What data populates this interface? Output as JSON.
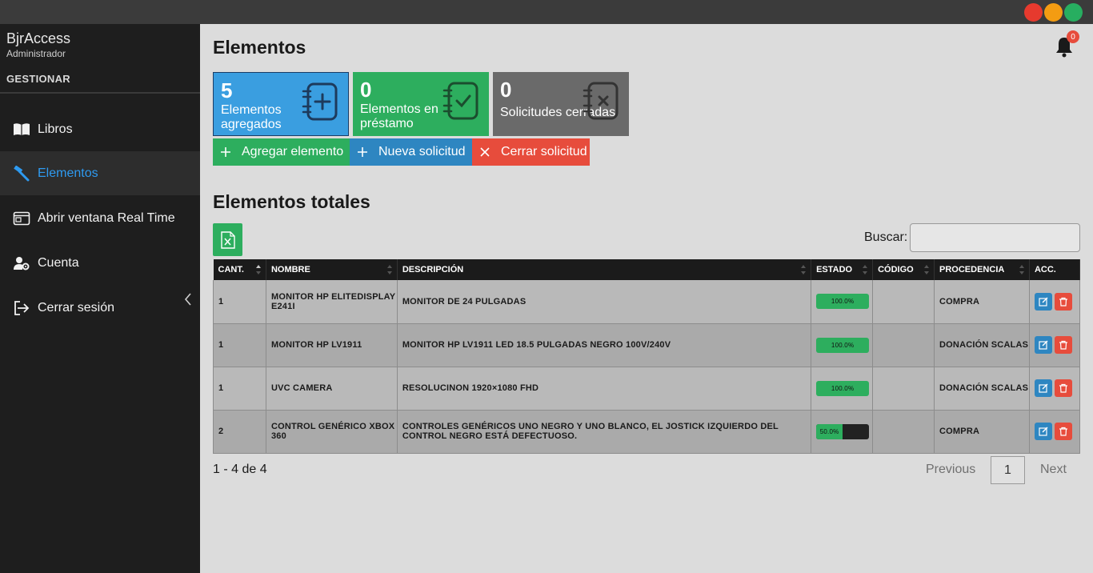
{
  "window": {
    "controls": [
      "close",
      "minimize",
      "maximize"
    ],
    "colors": {
      "close": "#e63a2e",
      "minimize": "#f39c12",
      "maximize": "#27ae60"
    }
  },
  "sidebar": {
    "app_name": "BjrAccess",
    "role": "Administrador",
    "section": "GESTIONAR",
    "items": [
      {
        "label": "Libros",
        "icon": "book-icon",
        "active": false
      },
      {
        "label": "Elementos",
        "icon": "hammer-icon",
        "active": true
      },
      {
        "label": "Abrir ventana Real Time",
        "icon": "window-icon",
        "active": false
      },
      {
        "label": "Cuenta",
        "icon": "user-gear-icon",
        "active": false
      },
      {
        "label": "Cerrar sesión",
        "icon": "logout-icon",
        "active": false
      }
    ]
  },
  "header": {
    "title": "Elementos",
    "notifications": "0"
  },
  "cards": [
    {
      "value": "5",
      "label": "Elementos agregados",
      "color": "#3a9ee0",
      "icon": "notebook-plus-icon"
    },
    {
      "value": "0",
      "label": "Elementos en préstamo",
      "color": "#2dae5e",
      "icon": "notebook-check-icon"
    },
    {
      "value": "0",
      "label": "Solicitudes cerradas",
      "color": "#6a6a6a",
      "icon": "notebook-x-icon"
    }
  ],
  "actions": {
    "add": "Agregar elemento",
    "new_request": "Nueva solicitud",
    "close_request": "Cerrar solicitud"
  },
  "table_section": {
    "title": "Elementos totales",
    "search_label": "Buscar:",
    "search_value": ""
  },
  "table": {
    "columns": [
      "CANT.",
      "NOMBRE",
      "DESCRIPCIÓN",
      "ESTADO",
      "CÓDIGO",
      "PROCEDENCIA",
      "ACC."
    ],
    "rows": [
      {
        "cant": "1",
        "nombre": "MONITOR HP ELITEDISPLAY E241I",
        "descripcion": "MONITOR DE 24 PULGADAS",
        "estado": "100.0%",
        "estado_value": 100,
        "codigo": "",
        "procedencia": "COMPRA"
      },
      {
        "cant": "1",
        "nombre": "MONITOR HP LV1911",
        "descripcion": "MONITOR HP LV1911 LED 18.5 PULGADAS NEGRO 100V/240V",
        "estado": "100.0%",
        "estado_value": 100,
        "codigo": "",
        "procedencia": "DONACIÓN SCALAS"
      },
      {
        "cant": "1",
        "nombre": "UVC CAMERA",
        "descripcion": "RESOLUCINON 1920×1080 FHD",
        "estado": "100.0%",
        "estado_value": 100,
        "codigo": "",
        "procedencia": "DONACIÓN SCALAS"
      },
      {
        "cant": "2",
        "nombre": "CONTROL GENÉRICO XBOX 360",
        "descripcion": "CONTROLES GENÉRICOS UNO NEGRO Y UNO BLANCO, EL JOSTICK IZQUIERDO DEL CONTROL NEGRO ESTÁ DEFECTUOSO.",
        "estado": "50.0%",
        "estado_value": 50,
        "codigo": "",
        "procedencia": "COMPRA"
      }
    ]
  },
  "pagination": {
    "info": "1 - 4 de 4",
    "previous": "Previous",
    "page": "1",
    "next": "Next"
  }
}
